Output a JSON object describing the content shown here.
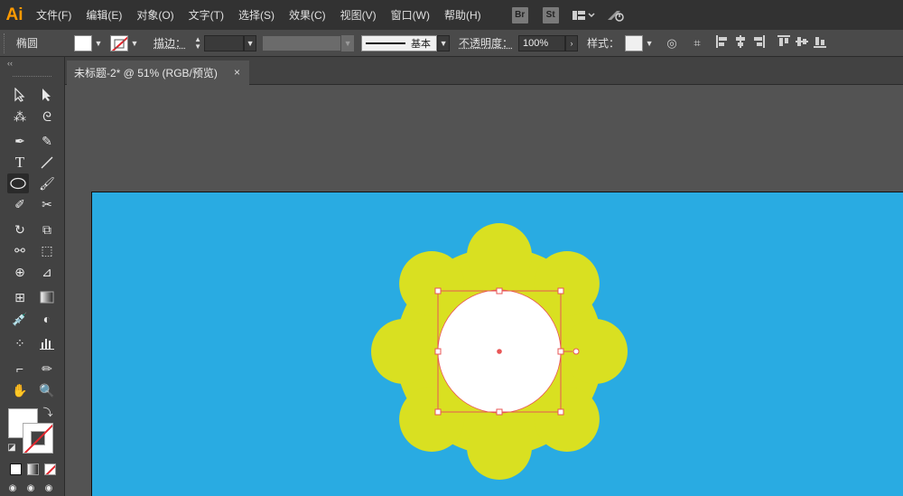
{
  "app": {
    "logo": "Ai"
  },
  "menu": [
    "文件(F)",
    "编辑(E)",
    "对象(O)",
    "文字(T)",
    "选择(S)",
    "效果(C)",
    "视图(V)",
    "窗口(W)",
    "帮助(H)"
  ],
  "menu_buttons": {
    "bridge": "Br",
    "stock": "St"
  },
  "control": {
    "selection_type": "椭圆",
    "stroke_label": "描边：",
    "brush_label": "基本",
    "opacity_label": "不透明度：",
    "opacity_value": "100%",
    "style_label": "样式："
  },
  "tab": {
    "title": "未标题-2* @ 51% (RGB/预览)",
    "close": "×"
  },
  "toolbar": {
    "collapse": "‹‹"
  },
  "colors": {
    "artboard_bg": "#29abe2",
    "flower_fill": "#d9e021",
    "circle_fill": "#ffffff",
    "selection": "#e85656"
  }
}
